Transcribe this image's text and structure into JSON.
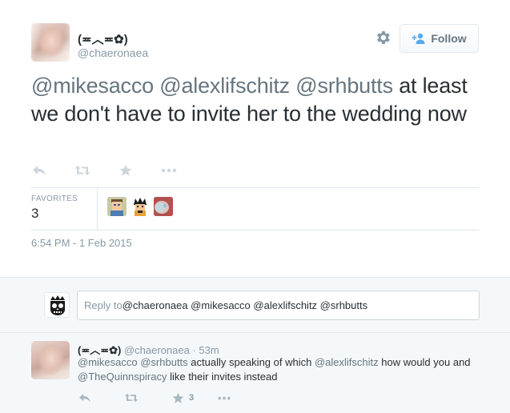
{
  "tweet": {
    "display_name": "(≖︿≖✿)",
    "username": "@chaeronaea",
    "follow_label": "Follow",
    "text_mentions": [
      "@mikesacco",
      "@alexlifschitz",
      "@srhbutts"
    ],
    "text_body": " at least we don't have to invite her to the wedding now",
    "favorites_label": "FAVORITES",
    "favorites_count": "3",
    "timestamp": "6:54 PM - 1 Feb 2015"
  },
  "reply_box": {
    "prefix": "Reply to ",
    "names": "@chaeronaea @mikesacco @alexlifschitz @srhbutts"
  },
  "reply_tweet": {
    "display_name": "(≖︿≖✿)",
    "username": "@chaeronaea",
    "separator": " · ",
    "time": "53m",
    "text_parts": [
      {
        "t": "@mikesacco",
        "m": true
      },
      {
        "t": " ",
        "m": false
      },
      {
        "t": "@srhbutts",
        "m": true
      },
      {
        "t": " actually speaking of which ",
        "m": false
      },
      {
        "t": "@alexlifschitz",
        "m": true
      },
      {
        "t": " how would you and ",
        "m": false
      },
      {
        "t": "@TheQuinnspiracy",
        "m": true
      },
      {
        "t": " like their invites instead",
        "m": false
      }
    ],
    "favorite_count": "3"
  },
  "icons": [
    "gear-icon",
    "follow-person-icon",
    "reply-icon",
    "retweet-icon",
    "favorite-star-icon",
    "more-icon"
  ],
  "colors": {
    "text": "#292f33",
    "muted": "#8899a6",
    "mention": "#66757f",
    "action": "#ccd6dd",
    "background_alt": "#f5f8fa"
  }
}
